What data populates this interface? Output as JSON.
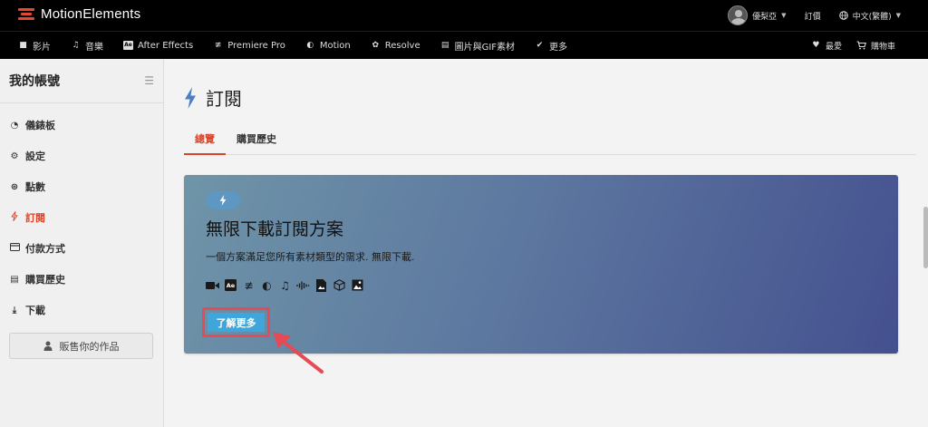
{
  "brand": {
    "name": "MotionElements",
    "accent": "#e8472f"
  },
  "header": {
    "user_name": "優梨亞",
    "subscribe": "訂價",
    "language": "中文(繁體)"
  },
  "nav": {
    "items": [
      {
        "icon": "video-icon",
        "label": "影片"
      },
      {
        "icon": "music-icon",
        "label": "音樂"
      },
      {
        "icon": "after-effects-icon",
        "label": "After Effects"
      },
      {
        "icon": "premiere-icon",
        "label": "Premiere Pro"
      },
      {
        "icon": "motion-icon",
        "label": "Motion"
      },
      {
        "icon": "resolve-icon",
        "label": "Resolve"
      },
      {
        "icon": "image-file-icon",
        "label": "圖片與GIF素材"
      },
      {
        "icon": "more-icon",
        "label": "更多"
      }
    ],
    "favorites": "最愛",
    "cart": "購物車"
  },
  "sidebar": {
    "title": "我的帳號",
    "items": [
      {
        "icon": "dashboard-icon",
        "label": "儀錶板"
      },
      {
        "icon": "gear-icon",
        "label": "設定"
      },
      {
        "icon": "points-icon",
        "label": "點數"
      },
      {
        "icon": "bolt-icon",
        "label": "訂閱"
      },
      {
        "icon": "credit-card-icon",
        "label": "付款方式"
      },
      {
        "icon": "receipt-icon",
        "label": "購買歷史"
      },
      {
        "icon": "download-icon",
        "label": "下載"
      }
    ],
    "active_index": 3,
    "sell_button": "販售你的作品"
  },
  "main": {
    "title": "訂閱",
    "tabs": [
      "總覽",
      "購買歷史"
    ],
    "active_tab": 0,
    "promo": {
      "title": "無限下載訂閱方案",
      "description": "一個方案滿足您所有素材類型的需求. 無限下載.",
      "button": "了解更多"
    }
  },
  "colors": {
    "active": "#d9442a",
    "button": "#3ea6db",
    "highlight": "#e54a55"
  }
}
